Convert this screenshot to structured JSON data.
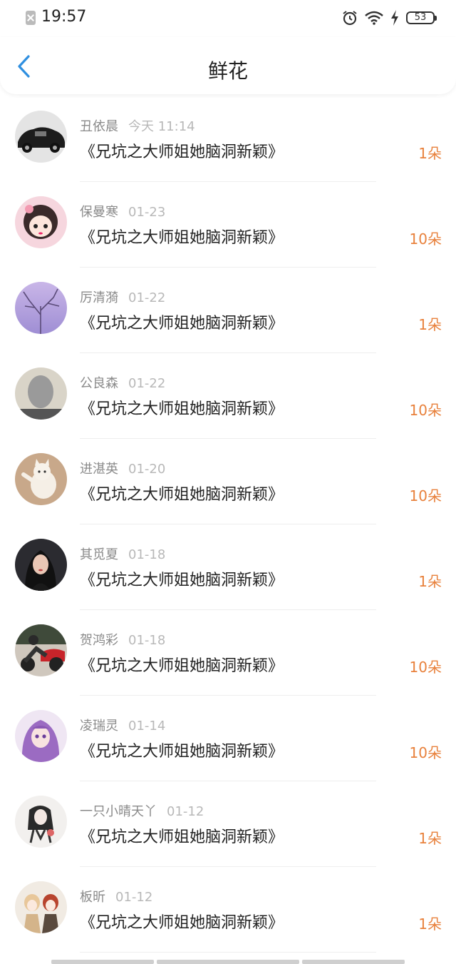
{
  "statusbar": {
    "time": "19:57",
    "battery": "53",
    "icons": [
      "notification-blocked-icon",
      "alarm-icon",
      "wifi-icon",
      "charging-icon",
      "battery-icon"
    ]
  },
  "nav": {
    "title": "鲜花",
    "back_icon": "chevron-left-icon",
    "accent": "#2f8fe0"
  },
  "colors": {
    "count": "#e8813c",
    "name": "#8a8a8a",
    "time": "#b8b8b8"
  },
  "items": [
    {
      "name": "丑依晨",
      "time": "今天 11:14",
      "book": "《兄坑之大师姐她脑洞新颖》",
      "count": "1朵",
      "avatar": "vintage-car-avatar"
    },
    {
      "name": "保曼寒",
      "time": "01-23",
      "book": "《兄坑之大师姐她脑洞新颖》",
      "count": "10朵",
      "avatar": "cartoon-girl-avatar"
    },
    {
      "name": "厉清漪",
      "time": "01-22",
      "book": "《兄坑之大师姐她脑洞新颖》",
      "count": "1朵",
      "avatar": "purple-tree-avatar"
    },
    {
      "name": "公良森",
      "time": "01-22",
      "book": "《兄坑之大师姐她脑洞新颖》",
      "count": "10朵",
      "avatar": "blurred-person-avatar"
    },
    {
      "name": "进湛英",
      "time": "01-20",
      "book": "《兄坑之大师姐她脑洞新颖》",
      "count": "10朵",
      "avatar": "cat-avatar"
    },
    {
      "name": "其觅夏",
      "time": "01-18",
      "book": "《兄坑之大师姐她脑洞新颖》",
      "count": "1朵",
      "avatar": "woman-portrait-avatar"
    },
    {
      "name": "贺鸿彩",
      "time": "01-18",
      "book": "《兄坑之大师姐她脑洞新颖》",
      "count": "10朵",
      "avatar": "motorcycle-avatar"
    },
    {
      "name": "凌瑞灵",
      "time": "01-14",
      "book": "《兄坑之大师姐她脑洞新颖》",
      "count": "10朵",
      "avatar": "anime-girl-avatar"
    },
    {
      "name": "一只小晴天丫",
      "time": "01-12",
      "book": "《兄坑之大师姐她脑洞新颖》",
      "count": "1朵",
      "avatar": "sketch-girl-avatar"
    },
    {
      "name": "板昕",
      "time": "01-12",
      "book": "《兄坑之大师姐她脑洞新颖》",
      "count": "1朵",
      "avatar": "anime-couple-avatar"
    }
  ]
}
